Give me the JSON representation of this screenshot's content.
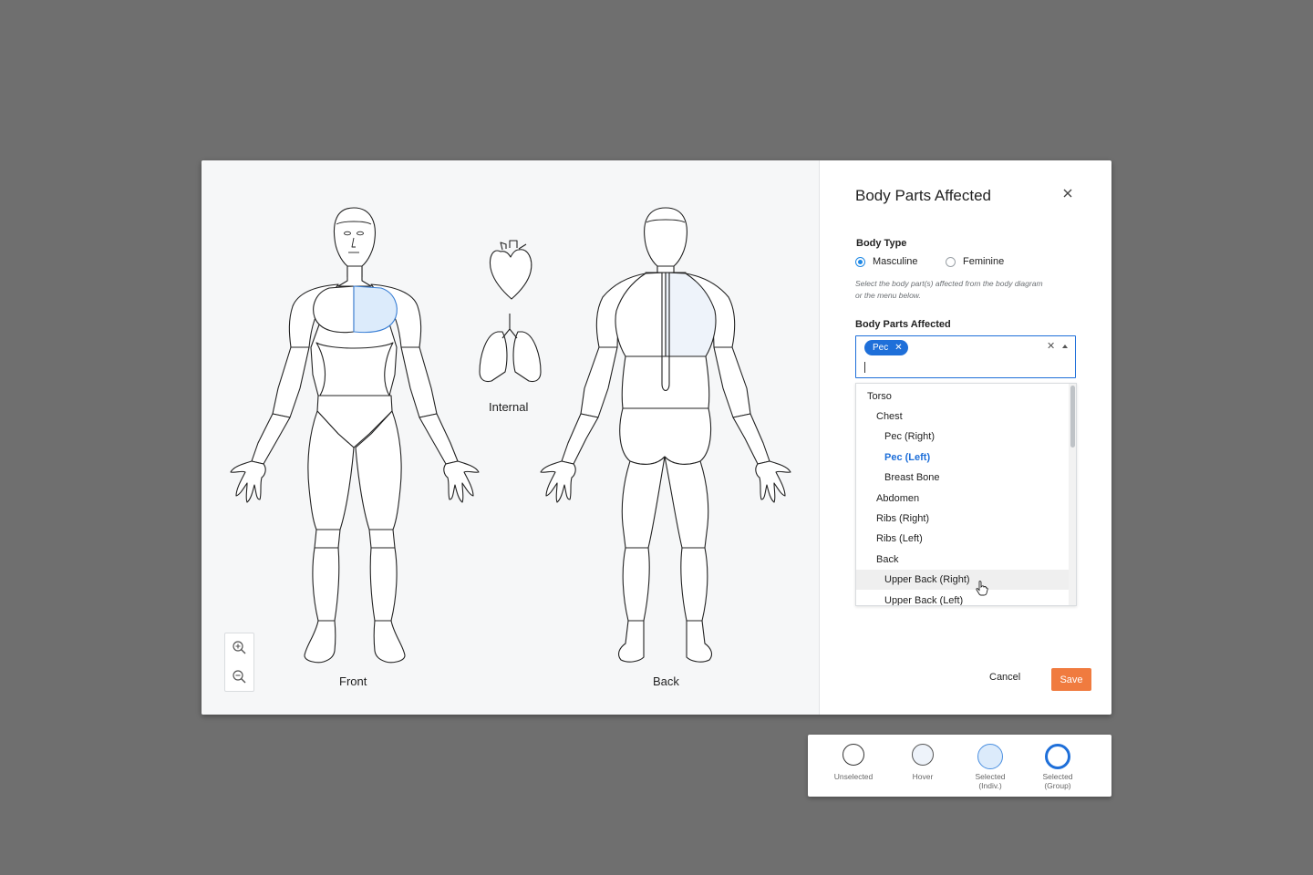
{
  "diagram": {
    "front_label": "Front",
    "internal_label": "Internal",
    "back_label": "Back",
    "zoom_in": "zoom-in-icon",
    "zoom_out": "zoom-out-icon"
  },
  "panel": {
    "title": "Body Parts Affected",
    "body_type_label": "Body Type",
    "body_type_options": [
      {
        "label": "Masculine",
        "selected": true
      },
      {
        "label": "Feminine",
        "selected": false
      }
    ],
    "hint": "Select the body part(s) affected from the body diagram or the menu below.",
    "parts_label": "Body Parts Affected",
    "chips": [
      {
        "label": "Pec"
      }
    ],
    "options": [
      {
        "label": "Torso",
        "level": 0
      },
      {
        "label": "Chest",
        "level": 1
      },
      {
        "label": "Pec (Right)",
        "level": 2
      },
      {
        "label": "Pec (Left)",
        "level": 2,
        "selected": true
      },
      {
        "label": "Breast Bone",
        "level": 2
      },
      {
        "label": "Abdomen",
        "level": 1
      },
      {
        "label": "Ribs (Right)",
        "level": 1
      },
      {
        "label": "Ribs (Left)",
        "level": 1
      },
      {
        "label": "Back",
        "level": 1
      },
      {
        "label": "Upper Back (Right)",
        "level": 2,
        "hover": true
      },
      {
        "label": "Upper Back (Left)",
        "level": 2
      }
    ],
    "cancel_label": "Cancel",
    "save_label": "Save"
  },
  "legend": [
    {
      "label": "Unselected",
      "state": "unselected"
    },
    {
      "label": "Hover",
      "state": "hover"
    },
    {
      "label": "Selected\n(Indiv.)",
      "state": "selected-individual"
    },
    {
      "label": "Selected\n(Group)",
      "state": "selected-group"
    }
  ],
  "colors": {
    "accent": "#1e6fd9",
    "save": "#f07b3f",
    "selected_fill": "#dcebfb",
    "hover_fill": "#eef3fa"
  }
}
